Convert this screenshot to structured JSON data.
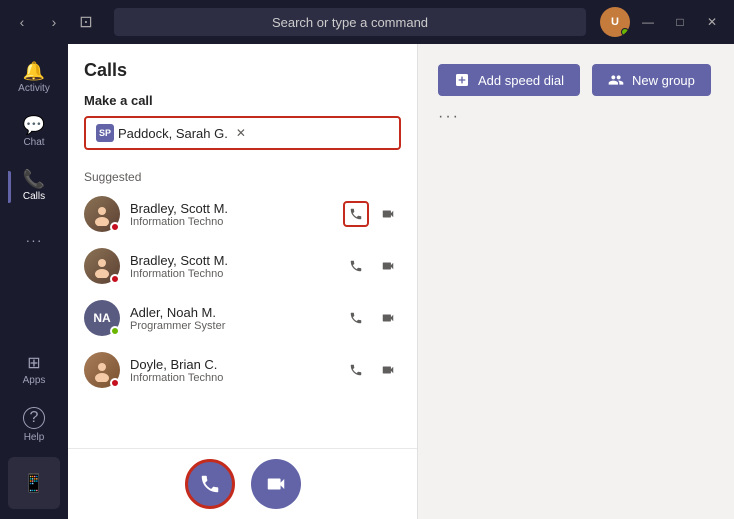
{
  "titlebar": {
    "back_label": "‹",
    "forward_label": "›",
    "new_window_label": "⊡",
    "search_placeholder": "Search or type a command",
    "minimize": "—",
    "maximize": "□",
    "close": "✕"
  },
  "sidebar": {
    "items": [
      {
        "id": "activity",
        "label": "Activity",
        "icon": "🔔"
      },
      {
        "id": "chat",
        "label": "Chat",
        "icon": "💬"
      },
      {
        "id": "calls",
        "label": "Calls",
        "icon": "📞",
        "active": true
      },
      {
        "id": "more",
        "label": "...",
        "icon": "···"
      },
      {
        "id": "apps",
        "label": "Apps",
        "icon": "⊞"
      },
      {
        "id": "help",
        "label": "Help",
        "icon": "?"
      }
    ]
  },
  "left_panel": {
    "title": "Calls",
    "make_call_label": "Make a call",
    "caller": {
      "initials": "SP",
      "name": "Paddock, Sarah G.",
      "remove": "✕"
    },
    "suggested_label": "Suggested",
    "contacts": [
      {
        "id": "scott1",
        "name": "Bradley, Scott M.",
        "dept": "Information Techno",
        "status": "busy",
        "avatar_type": "photo",
        "highlighted_action": true
      },
      {
        "id": "scott2",
        "name": "Bradley, Scott M.",
        "dept": "Information Techno",
        "status": "busy",
        "avatar_type": "photo",
        "highlighted_action": false
      },
      {
        "id": "noah",
        "name": "Adler, Noah M.",
        "dept": "Programmer Syster",
        "status": "online",
        "avatar_type": "initials",
        "initials": "NA",
        "highlighted_action": false
      },
      {
        "id": "doyle",
        "name": "Doyle, Brian C.",
        "dept": "Information Techno",
        "status": "busy",
        "avatar_type": "photo",
        "highlighted_action": false
      }
    ]
  },
  "bottom_call_bar": {
    "audio_call_icon": "📞",
    "video_call_icon": "📹"
  },
  "right_panel": {
    "add_speed_dial_label": "Add speed dial",
    "new_group_label": "New group",
    "more_options": "···"
  }
}
